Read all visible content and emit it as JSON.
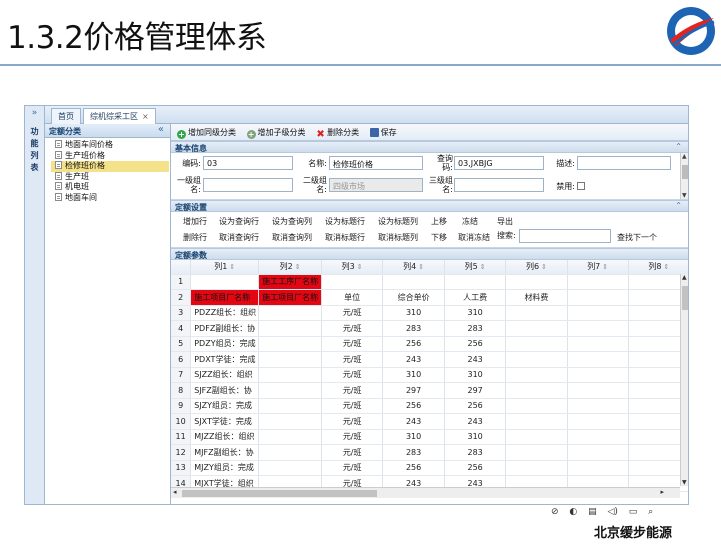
{
  "slide": {
    "title": "1.3.2价格管理体系",
    "brand": "北京缓步能源",
    "bottom_icons": "⊘ ◐ ▤ ◁) ▭ ⌕"
  },
  "app": {
    "rail_arrows": "»",
    "rail_label": "功 能 列 表",
    "tabs": [
      {
        "label": "首页"
      },
      {
        "label": "综机综采工区",
        "close": "×"
      }
    ],
    "tree_header": "定额分类",
    "tree_collapse": "«",
    "tree_items": [
      "地面车间价格",
      "生产班价格",
      "检修班价格",
      "生产班",
      "机电班",
      "地面车间"
    ],
    "toolbar": {
      "add_sibling": "增加同级分类",
      "add_child": "增加子级分类",
      "delete": "删除分类",
      "save": "保存"
    },
    "basic": {
      "header": "基本信息",
      "code_label": "编码:",
      "code_value": "03",
      "name_label": "名称:",
      "name_value": "检修班价格",
      "query_label": "查询码:",
      "query_value": "03,JXBJG",
      "desc_label": "描述:",
      "desc_value": "",
      "level1_label": "一级组名:",
      "level1_value": "",
      "level2_label": "二级组名:",
      "level2_value": "四级市场",
      "level3_label": "三级组名:",
      "level3_value": "",
      "disabled_label": "禁用:"
    },
    "settings": {
      "header": "定额设置",
      "row1": [
        "增加行",
        "设为查询行",
        "设为查询列",
        "设为标题行",
        "设为标题列",
        "上移",
        "冻结",
        "导出"
      ],
      "row2": [
        "删除行",
        "取消查询行",
        "取消查询列",
        "取消标题行",
        "取消标题列",
        "下移",
        "取消冻结"
      ],
      "search_label": "搜索:",
      "search_value": "",
      "find_next": "查找下一个"
    },
    "params": {
      "header": "定额参数",
      "columns": [
        "列1",
        "列2",
        "列3",
        "列4",
        "列5",
        "列6",
        "列7",
        "列8"
      ],
      "rows": [
        {
          "n": "1",
          "c": [
            "",
            "施工工序厂名称",
            "",
            "",
            "",
            "",
            "",
            ""
          ]
        },
        {
          "n": "2",
          "c": [
            "施工项目厂名称",
            "施工项目厂名称",
            "单位",
            "综合单价",
            "人工费",
            "材料费",
            "",
            ""
          ]
        },
        {
          "n": "3",
          "c": [
            "PDZZ组长：组织",
            "",
            "元/班",
            "310",
            "310",
            "",
            "",
            ""
          ]
        },
        {
          "n": "4",
          "c": [
            "PDFZ副组长：协",
            "",
            "元/班",
            "283",
            "283",
            "",
            "",
            ""
          ]
        },
        {
          "n": "5",
          "c": [
            "PDZY组员：完成",
            "",
            "元/班",
            "256",
            "256",
            "",
            "",
            ""
          ]
        },
        {
          "n": "6",
          "c": [
            "PDXT学徒：完成",
            "",
            "元/班",
            "243",
            "243",
            "",
            "",
            ""
          ]
        },
        {
          "n": "7",
          "c": [
            "SJZZ组长：组织",
            "",
            "元/班",
            "310",
            "310",
            "",
            "",
            ""
          ]
        },
        {
          "n": "8",
          "c": [
            "SJFZ副组长：协",
            "",
            "元/班",
            "297",
            "297",
            "",
            "",
            ""
          ]
        },
        {
          "n": "9",
          "c": [
            "SJZY组员：完成",
            "",
            "元/班",
            "256",
            "256",
            "",
            "",
            ""
          ]
        },
        {
          "n": "10",
          "c": [
            "SJXT学徒：完成",
            "",
            "元/班",
            "243",
            "243",
            "",
            "",
            ""
          ]
        },
        {
          "n": "11",
          "c": [
            "MJZZ组长：组织",
            "",
            "元/班",
            "310",
            "310",
            "",
            "",
            ""
          ]
        },
        {
          "n": "12",
          "c": [
            "MJFZ副组长：协",
            "",
            "元/班",
            "283",
            "283",
            "",
            "",
            ""
          ]
        },
        {
          "n": "13",
          "c": [
            "MJZY组员：完成",
            "",
            "元/班",
            "256",
            "256",
            "",
            "",
            ""
          ]
        },
        {
          "n": "14",
          "c": [
            "MJXT学徒：组织",
            "",
            "元/班",
            "243",
            "243",
            "",
            "",
            ""
          ]
        }
      ]
    }
  },
  "colors": {
    "accent": "#15406d",
    "highlight_red": "#e30613",
    "selected_tree": "#f3e28a"
  }
}
